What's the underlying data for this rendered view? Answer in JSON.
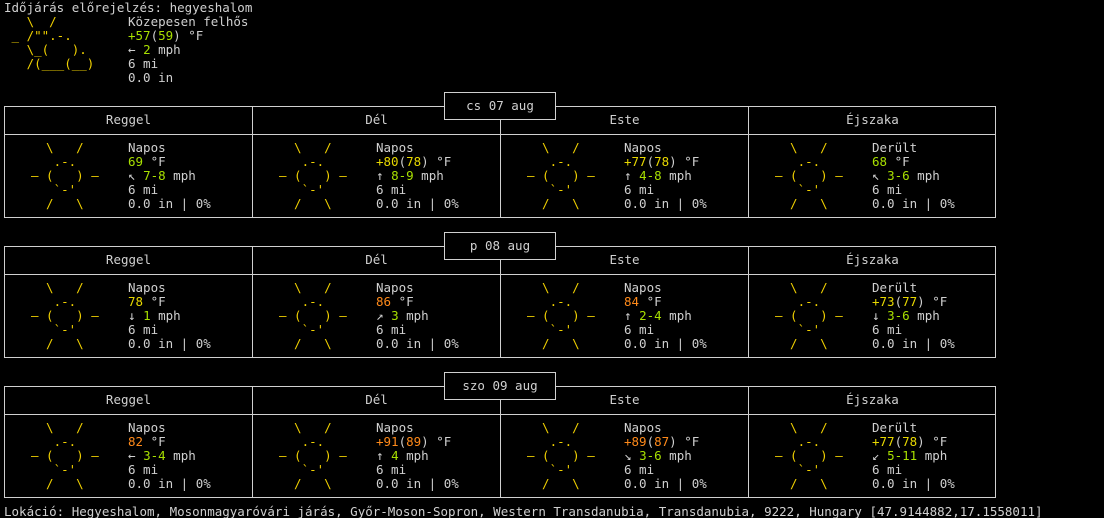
{
  "header": {
    "title": "Időjárás előrejelzés: hegyeshalom",
    "art": [
      "   \\  /       ",
      " _ /\"\".-.     ",
      "   \\_(   ).   ",
      "   /(___(__)  "
    ],
    "condition": "Közepesen felhős",
    "temp_main": "+57",
    "temp_feels": "59",
    "temp_unit": " °F",
    "wind_arrow": "←",
    "wind_speed": "2",
    "wind_unit": " mph",
    "visibility": "6 mi",
    "precip": "0.0 in"
  },
  "sun_art": [
    "  \\   /  ",
    "   .-.   ",
    "― (   ) ―",
    "   `-'   ",
    "  /   \\  "
  ],
  "periods": [
    "Reggel",
    "Dél",
    "Este",
    "Éjszaka"
  ],
  "days": [
    {
      "date": "cs 07 aug",
      "cells": [
        {
          "cond": "Napos",
          "temp": "69",
          "feels": "",
          "tcolor": "c-lg",
          "arrow": "↖",
          "wind": "7-8",
          "vis": "6 mi",
          "precip": "0.0 in | 0%"
        },
        {
          "cond": "Napos",
          "temp": "+80",
          "feels": "78",
          "tcolor": "c-y",
          "arrow": "↑",
          "wind": "8-9",
          "vis": "6 mi",
          "precip": "0.0 in | 0%"
        },
        {
          "cond": "Napos",
          "temp": "+77",
          "feels": "78",
          "tcolor": "c-y",
          "arrow": "↑",
          "wind": "4-8",
          "vis": "6 mi",
          "precip": "0.0 in | 0%"
        },
        {
          "cond": "Derült",
          "temp": "68",
          "feels": "",
          "tcolor": "c-lg",
          "arrow": "↖",
          "wind": "3-6",
          "vis": "6 mi",
          "precip": "0.0 in | 0%"
        }
      ]
    },
    {
      "date": "p 08 aug",
      "cells": [
        {
          "cond": "Napos",
          "temp": "78",
          "feels": "",
          "tcolor": "c-y",
          "arrow": "↓",
          "wind": "1",
          "vis": "6 mi",
          "precip": "0.0 in | 0%"
        },
        {
          "cond": "Napos",
          "temp": "86",
          "feels": "",
          "tcolor": "c-o",
          "arrow": "↗",
          "wind": "3",
          "vis": "6 mi",
          "precip": "0.0 in | 0%"
        },
        {
          "cond": "Napos",
          "temp": "84",
          "feels": "",
          "tcolor": "c-o",
          "arrow": "↑",
          "wind": "2-4",
          "vis": "6 mi",
          "precip": "0.0 in | 0%"
        },
        {
          "cond": "Derült",
          "temp": "+73",
          "feels": "77",
          "tcolor": "c-y",
          "arrow": "↓",
          "wind": "3-6",
          "vis": "6 mi",
          "precip": "0.0 in | 0%"
        }
      ]
    },
    {
      "date": "szo 09 aug",
      "cells": [
        {
          "cond": "Napos",
          "temp": "82",
          "feels": "",
          "tcolor": "c-o",
          "arrow": "←",
          "wind": "3-4",
          "vis": "6 mi",
          "precip": "0.0 in | 0%"
        },
        {
          "cond": "Napos",
          "temp": "+91",
          "feels": "89",
          "tcolor": "c-o",
          "arrow": "↑",
          "wind": "4",
          "vis": "6 mi",
          "precip": "0.0 in | 0%"
        },
        {
          "cond": "Napos",
          "temp": "+89",
          "feels": "87",
          "tcolor": "c-o",
          "arrow": "↘",
          "wind": "3-6",
          "vis": "6 mi",
          "precip": "0.0 in | 0%"
        },
        {
          "cond": "Derült",
          "temp": "+77",
          "feels": "78",
          "tcolor": "c-y",
          "arrow": "↙",
          "wind": "5-11",
          "vis": "6 mi",
          "precip": "0.0 in | 0%"
        }
      ]
    }
  ],
  "units": {
    "temp": " °F",
    "wind": " mph"
  },
  "footer": "Lokáció: Hegyeshalom, Mosonmagyaróvári járás, Győr-Moson-Sopron, Western Transdanubia, Transdanubia, 9222, Hungary [47.9144882,17.1558011]"
}
